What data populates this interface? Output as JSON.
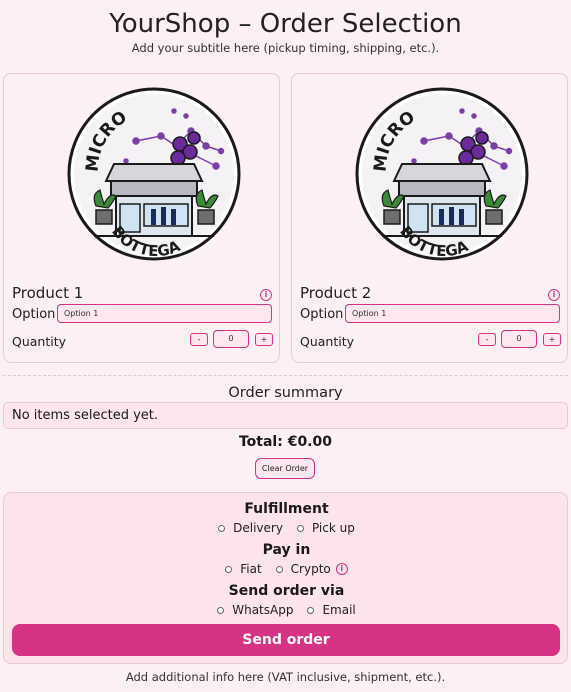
{
  "header": {
    "title": "YourShop – Order Selection",
    "subtitle": "Add your subtitle here (pickup timing, shipping, etc.)."
  },
  "products": [
    {
      "name": "Product 1",
      "option_label": "Option",
      "option_value": "Option 1",
      "quantity_label": "Quantity",
      "quantity": "0",
      "minus": "-",
      "plus": "+",
      "logo_top": "MICRO",
      "logo_bottom": "BOTTEGA"
    },
    {
      "name": "Product 2",
      "option_label": "Option",
      "option_value": "Option 1",
      "quantity_label": "Quantity",
      "quantity": "0",
      "minus": "-",
      "plus": "+",
      "logo_top": "MICRO",
      "logo_bottom": "BOTTEGA"
    }
  ],
  "summary": {
    "title": "Order summary",
    "empty_text": "No items selected yet.",
    "total": "Total: €0.00",
    "clear_label": "Clear Order"
  },
  "checkout": {
    "fulfillment_title": "Fulfillment",
    "fulfillment_options": [
      "Delivery",
      "Pick up"
    ],
    "payin_title": "Pay in",
    "payin_options": [
      "Fiat",
      "Crypto"
    ],
    "sendvia_title": "Send order via",
    "sendvia_options": [
      "WhatsApp",
      "Email"
    ],
    "send_label": "Send order"
  },
  "footer": {
    "text": "Add additional info here (VAT inclusive, shipment, etc.)."
  },
  "colors": {
    "accent": "#d63384",
    "background": "#fdf0f3"
  },
  "icons": {
    "info": "info-icon",
    "logo": "shop-logo"
  }
}
